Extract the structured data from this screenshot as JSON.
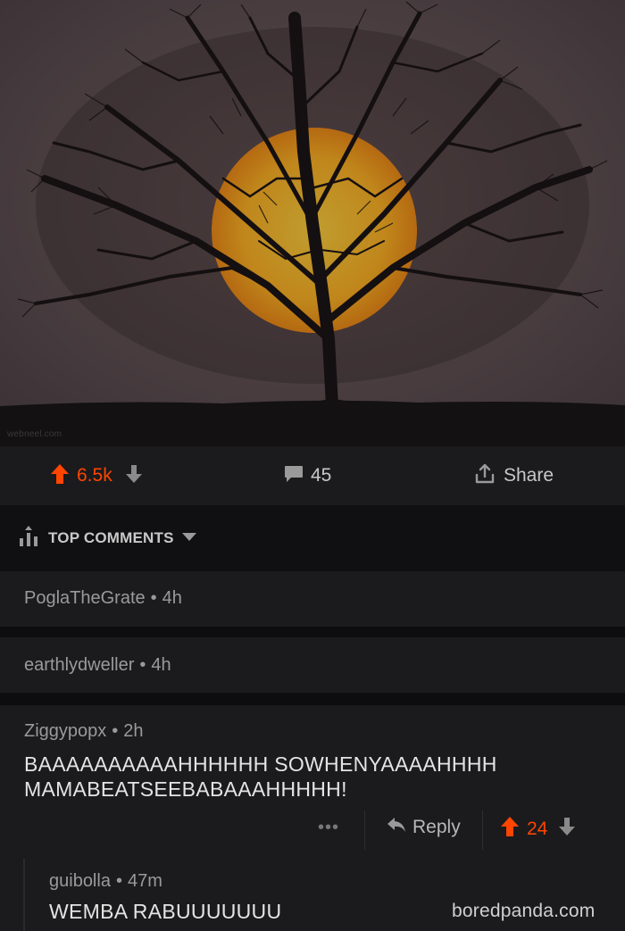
{
  "image": {
    "subject": "tree-silhouette-sunset",
    "watermark": "webneel.com",
    "colors": {
      "sky": "#4a3f44",
      "sun": "#ffb21e",
      "ground": "#131112"
    }
  },
  "post_actions": {
    "score": "6.5k",
    "comments_count": "45",
    "share_label": "Share"
  },
  "sort": {
    "label": "TOP COMMENTS"
  },
  "comments": [
    {
      "author": "PoglaTheGrate",
      "age": "4h",
      "collapsed": true
    },
    {
      "author": "earthlydweller",
      "age": "4h",
      "collapsed": true
    },
    {
      "author": "Ziggypopx",
      "age": "2h",
      "body_line1": "BAAAAAAAAAAHHHHHH SOWHENYAAAAHHHH",
      "body_line2": "MAMABEATSEEBABAAAHHHHH!",
      "more": "•••",
      "reply_label": "Reply",
      "score": "24"
    }
  ],
  "nested_reply": {
    "author": "guibolla",
    "age": "47m",
    "body": "WEMBA RABUUUUUUU"
  },
  "site_watermark": "boredpanda.com",
  "accent_color": "#ff4500"
}
